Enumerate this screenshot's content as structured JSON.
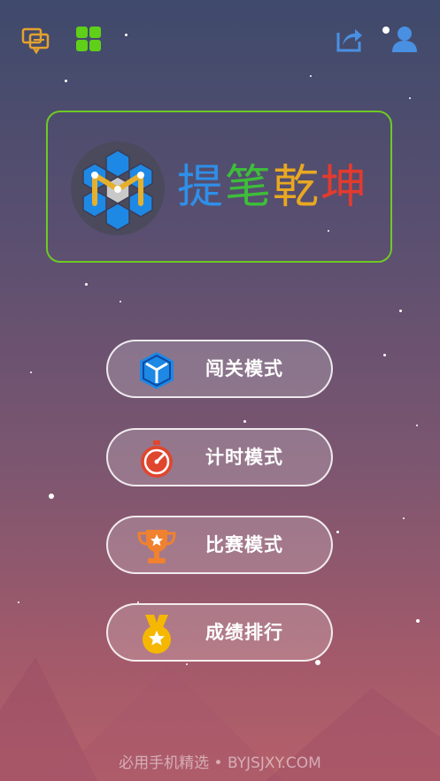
{
  "app": {
    "title_chars": [
      {
        "char": "提",
        "color": "#2f8fe8"
      },
      {
        "char": "笔",
        "color": "#3ebd3a"
      },
      {
        "char": "乾",
        "color": "#e9a821"
      },
      {
        "char": "坤",
        "color": "#e23b2f"
      }
    ]
  },
  "topbar": {
    "left": [
      {
        "icon": "chat-bubbles-icon",
        "color": "#e6a22c"
      },
      {
        "icon": "grid-apps-icon",
        "color": "#5fcf1a"
      }
    ],
    "right": [
      {
        "icon": "share-icon",
        "color": "#4a90e2"
      },
      {
        "icon": "user-icon",
        "color": "#4a90e2"
      }
    ]
  },
  "modes": [
    {
      "label": "闯关模式",
      "icon": "cube-icon",
      "color": "#1e88e5"
    },
    {
      "label": "计时模式",
      "icon": "stopwatch-icon",
      "color": "#e0452e"
    },
    {
      "label": "比赛模式",
      "icon": "trophy-icon",
      "color": "#f0812f"
    },
    {
      "label": "成绩排行",
      "icon": "medal-icon",
      "color": "#f5b700"
    }
  ],
  "footer": {
    "text": "必用手机精选 • BYJSJXY.COM"
  },
  "colors": {
    "logo_border": "#6fca24",
    "button_border": "#ffffff"
  }
}
